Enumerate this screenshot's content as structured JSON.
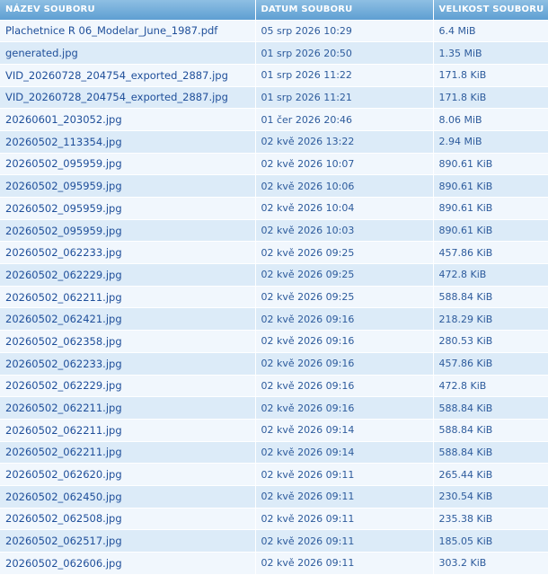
{
  "table": {
    "headers": {
      "name": "NÁZEV SOUBORU",
      "date": "DATUM SOUBORU",
      "size": "VELIKOST SOUBORU"
    },
    "rows": [
      {
        "name": "Plachetnice R 06_Modelar_June_1987.pdf",
        "date": "05 srp 2026 10:29",
        "size": "6.4 MiB"
      },
      {
        "name": "generated.jpg",
        "date": "01 srp 2026 20:50",
        "size": "1.35 MiB"
      },
      {
        "name": "VID_20260728_204754_exported_2887.jpg",
        "date": "01 srp 2026 11:22",
        "size": "171.8 KiB"
      },
      {
        "name": "VID_20260728_204754_exported_2887.jpg",
        "date": "01 srp 2026 11:21",
        "size": "171.8 KiB"
      },
      {
        "name": "20260601_203052.jpg",
        "date": "01 čer 2026 20:46",
        "size": "8.06 MiB"
      },
      {
        "name": "20260502_113354.jpg",
        "date": "02 kvě 2026 13:22",
        "size": "2.94 MiB"
      },
      {
        "name": "20260502_095959.jpg",
        "date": "02 kvě 2026 10:07",
        "size": "890.61 KiB"
      },
      {
        "name": "20260502_095959.jpg",
        "date": "02 kvě 2026 10:06",
        "size": "890.61 KiB"
      },
      {
        "name": "20260502_095959.jpg",
        "date": "02 kvě 2026 10:04",
        "size": "890.61 KiB"
      },
      {
        "name": "20260502_095959.jpg",
        "date": "02 kvě 2026 10:03",
        "size": "890.61 KiB"
      },
      {
        "name": "20260502_062233.jpg",
        "date": "02 kvě 2026 09:25",
        "size": "457.86 KiB"
      },
      {
        "name": "20260502_062229.jpg",
        "date": "02 kvě 2026 09:25",
        "size": "472.8 KiB"
      },
      {
        "name": "20260502_062211.jpg",
        "date": "02 kvě 2026 09:25",
        "size": "588.84 KiB"
      },
      {
        "name": "20260502_062421.jpg",
        "date": "02 kvě 2026 09:16",
        "size": "218.29 KiB"
      },
      {
        "name": "20260502_062358.jpg",
        "date": "02 kvě 2026 09:16",
        "size": "280.53 KiB"
      },
      {
        "name": "20260502_062233.jpg",
        "date": "02 kvě 2026 09:16",
        "size": "457.86 KiB"
      },
      {
        "name": "20260502_062229.jpg",
        "date": "02 kvě 2026 09:16",
        "size": "472.8 KiB"
      },
      {
        "name": "20260502_062211.jpg",
        "date": "02 kvě 2026 09:16",
        "size": "588.84 KiB"
      },
      {
        "name": "20260502_062211.jpg",
        "date": "02 kvě 2026 09:14",
        "size": "588.84 KiB"
      },
      {
        "name": "20260502_062211.jpg",
        "date": "02 kvě 2026 09:14",
        "size": "588.84 KiB"
      },
      {
        "name": "20260502_062620.jpg",
        "date": "02 kvě 2026 09:11",
        "size": "265.44 KiB"
      },
      {
        "name": "20260502_062450.jpg",
        "date": "02 kvě 2026 09:11",
        "size": "230.54 KiB"
      },
      {
        "name": "20260502_062508.jpg",
        "date": "02 kvě 2026 09:11",
        "size": "235.38 KiB"
      },
      {
        "name": "20260502_062517.jpg",
        "date": "02 kvě 2026 09:11",
        "size": "185.05 KiB"
      },
      {
        "name": "20260502_062606.jpg",
        "date": "02 kvě 2026 09:11",
        "size": "303.2 KiB"
      }
    ]
  },
  "colors": {
    "header_bg": "#5e9fd2",
    "row_odd": "#f1f7fd",
    "row_even": "#dcebf8",
    "link": "#1f4f9a"
  }
}
